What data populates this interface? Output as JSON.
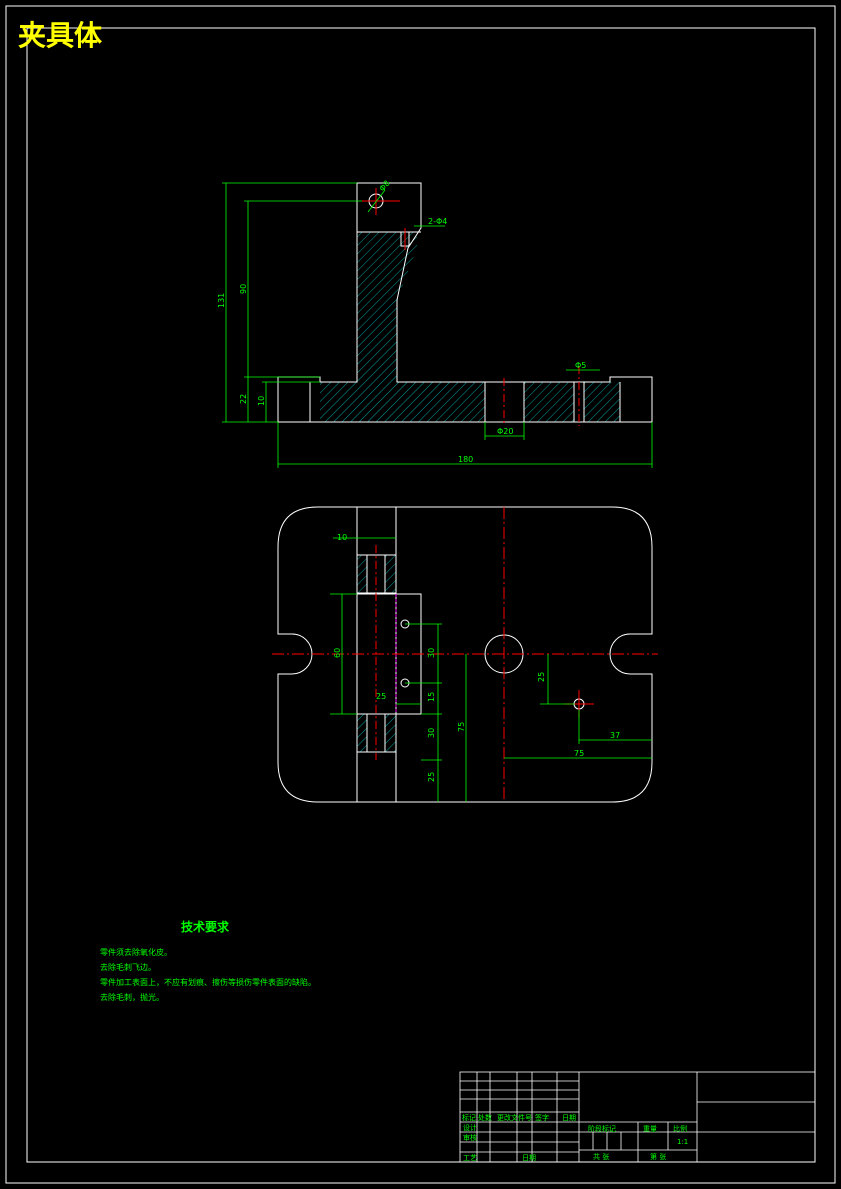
{
  "title": "夹具体",
  "colors": {
    "background": "#000000",
    "outline": "#ffffff",
    "dimension": "#00ff00",
    "centerline": "#ff0000",
    "hatch": "#00a0a0",
    "title_text": "#ffff00",
    "notes_text": "#00ff00",
    "hidden_line": "#ff00ff"
  },
  "front_view": {
    "dimensions": {
      "hole_dia": "Φ8",
      "chamfer": "2-Φ4",
      "total_height": "131",
      "upper_height": "90",
      "base_height": "22",
      "flange_height": "10",
      "small_hole": "Φ5",
      "center_hole": "Φ20",
      "total_width": "180"
    }
  },
  "top_view": {
    "dimensions": {
      "slot_width": "10",
      "block_height": "60",
      "pin_spacing": "30",
      "block_width": "25",
      "pin_offset": "15",
      "lower_offset": "30",
      "bottom_offset": "25",
      "center_height": "75",
      "hole_offset_y": "25",
      "hole_offset_x": "37",
      "center_offset_x": "75"
    }
  },
  "notes": {
    "title": "技术要求",
    "lines": [
      "零件须去除氧化皮。",
      "去除毛刺飞边。",
      "零件加工表面上，不应有划痕、擦伤等损伤零件表面的缺陷。",
      "去除毛刺，抛光。"
    ]
  },
  "title_block": {
    "labels": {
      "mark": "标记",
      "count": "处数",
      "change_doc": "更改文件号",
      "sign": "签字",
      "date": "日期",
      "design": "设计",
      "check": "审核",
      "process": "工艺",
      "approve": "日期",
      "stage": "阶段标记",
      "weight": "重量",
      "scale": "比例",
      "scale_value": "1:1",
      "sheets": "共 张",
      "sheet": "第 张"
    }
  }
}
